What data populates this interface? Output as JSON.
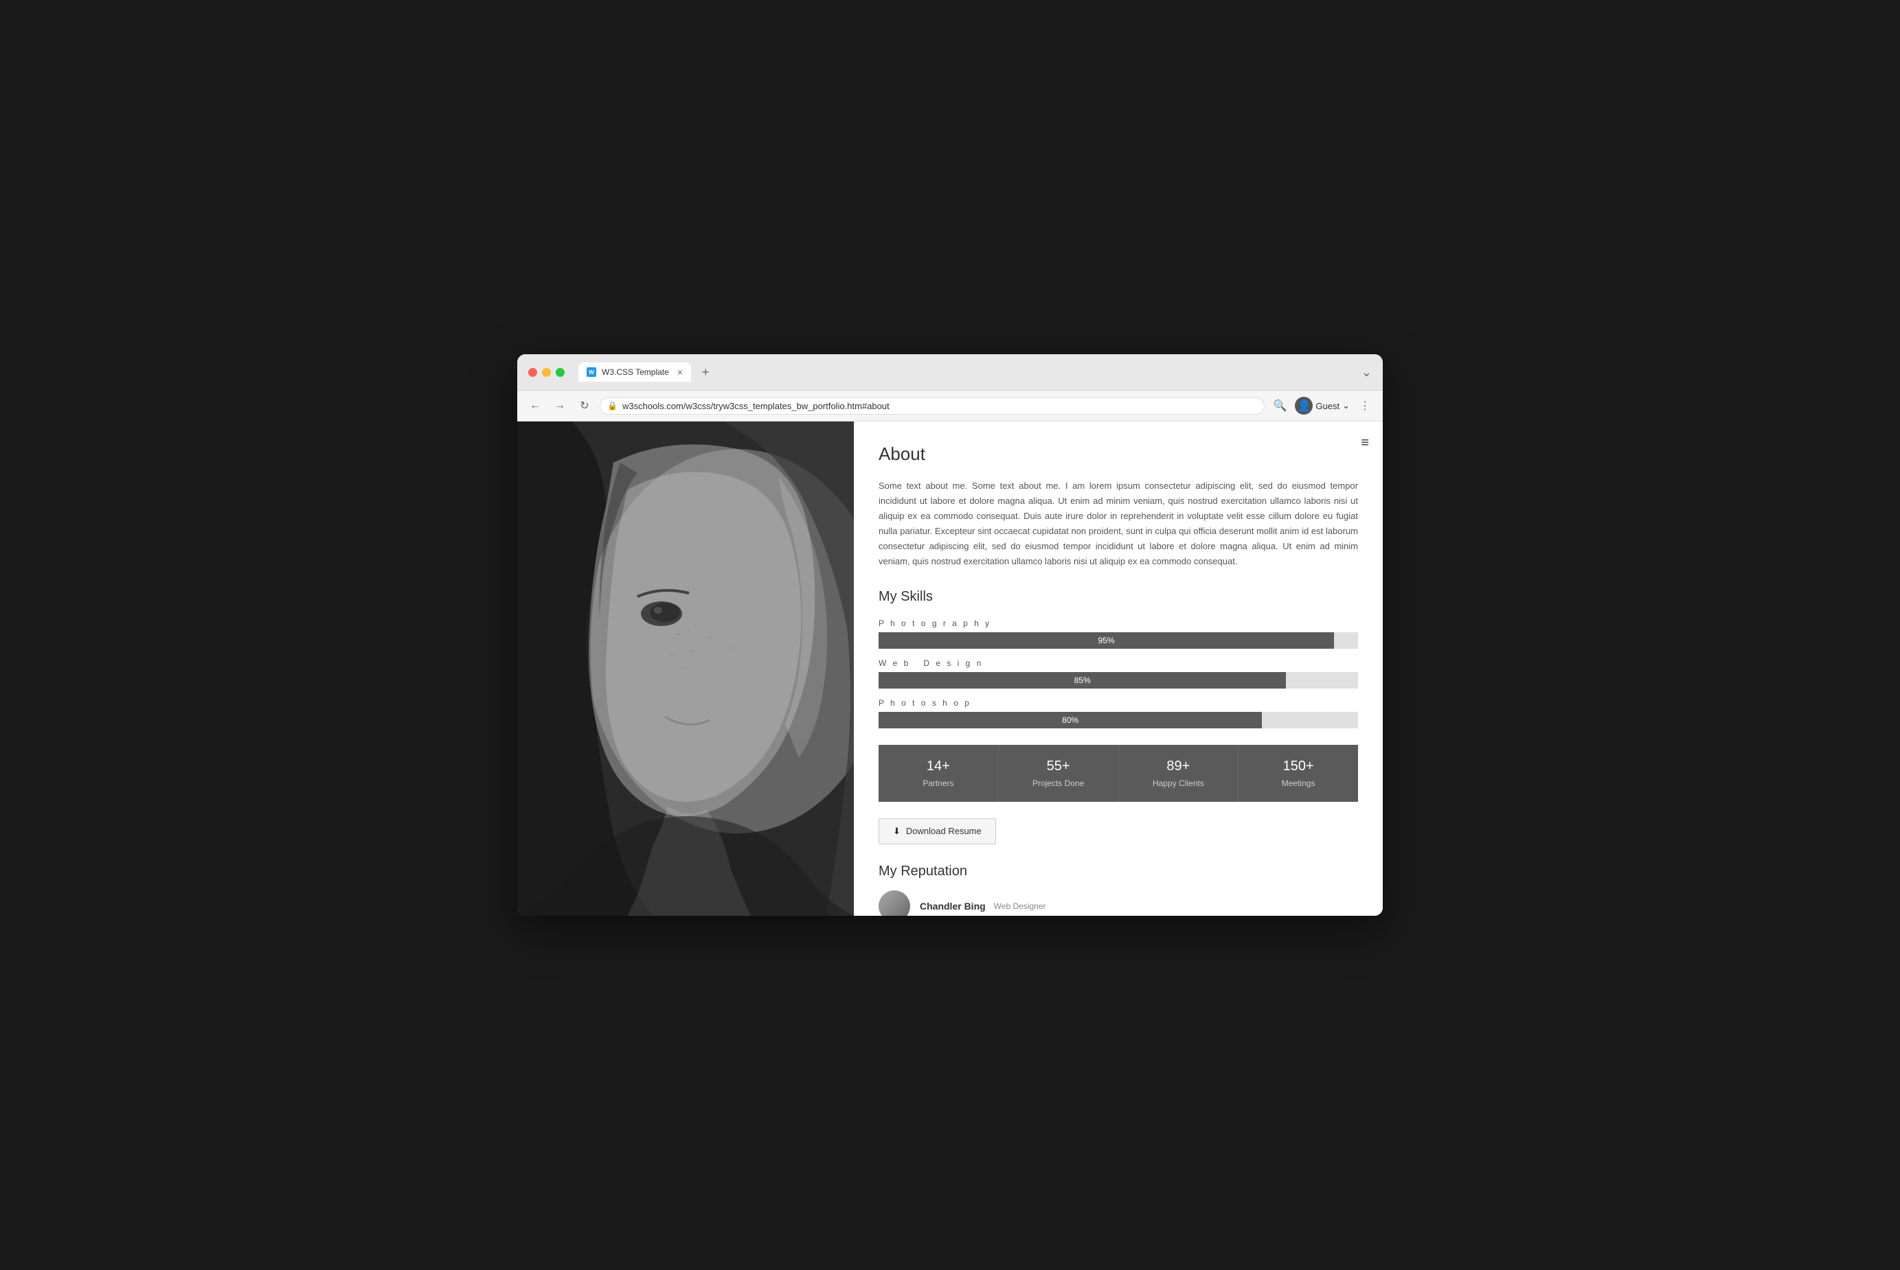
{
  "browser": {
    "tab_favicon": "W",
    "tab_title": "W3.CSS Template",
    "tab_close": "×",
    "tab_new": "+",
    "url": "w3schools.com/w3css/tryw3css_templates_bw_portfolio.htm#about",
    "user_label": "Guest",
    "chevron": "⌄"
  },
  "page": {
    "menu_icon": "≡",
    "about": {
      "title": "About",
      "body": "Some text about me. Some text about me. I am lorem ipsum consectetur adipiscing elit, sed do eiusmod tempor incididunt ut labore et dolore magna aliqua. Ut enim ad minim veniam, quis nostrud exercitation ullamco laboris nisi ut aliquip ex ea commodo consequat. Duis aute irure dolor in reprehenderit in voluptate velit esse cillum dolore eu fugiat nulla pariatur. Excepteur sint occaecat cupidatat non proident, sunt in culpa qui officia deserunt mollit anim id est laborum consectetur adipiscing elit, sed do eiusmod tempor incididunt ut labore et dolore magna aliqua. Ut enim ad minim veniam, quis nostrud exercitation ullamco laboris nisi ut aliquip ex ea commodo consequat."
    },
    "skills": {
      "title": "My Skills",
      "items": [
        {
          "label": "Photography",
          "percent": 95,
          "display": "95%"
        },
        {
          "label": "Web Design",
          "percent": 85,
          "display": "85%"
        },
        {
          "label": "Photoshop",
          "percent": 80,
          "display": "80%"
        }
      ]
    },
    "stats": [
      {
        "number": "14+",
        "label": "Partners"
      },
      {
        "number": "55+",
        "label": "Projects Done"
      },
      {
        "number": "89+",
        "label": "Happy Clients"
      },
      {
        "number": "150+",
        "label": "Meetings"
      }
    ],
    "download_btn": {
      "icon": "⬇",
      "label": "Download Resume"
    },
    "reputation": {
      "title": "My Reputation",
      "items": [
        {
          "name": "Chandler Bing",
          "role": "Web Designer"
        }
      ]
    }
  }
}
